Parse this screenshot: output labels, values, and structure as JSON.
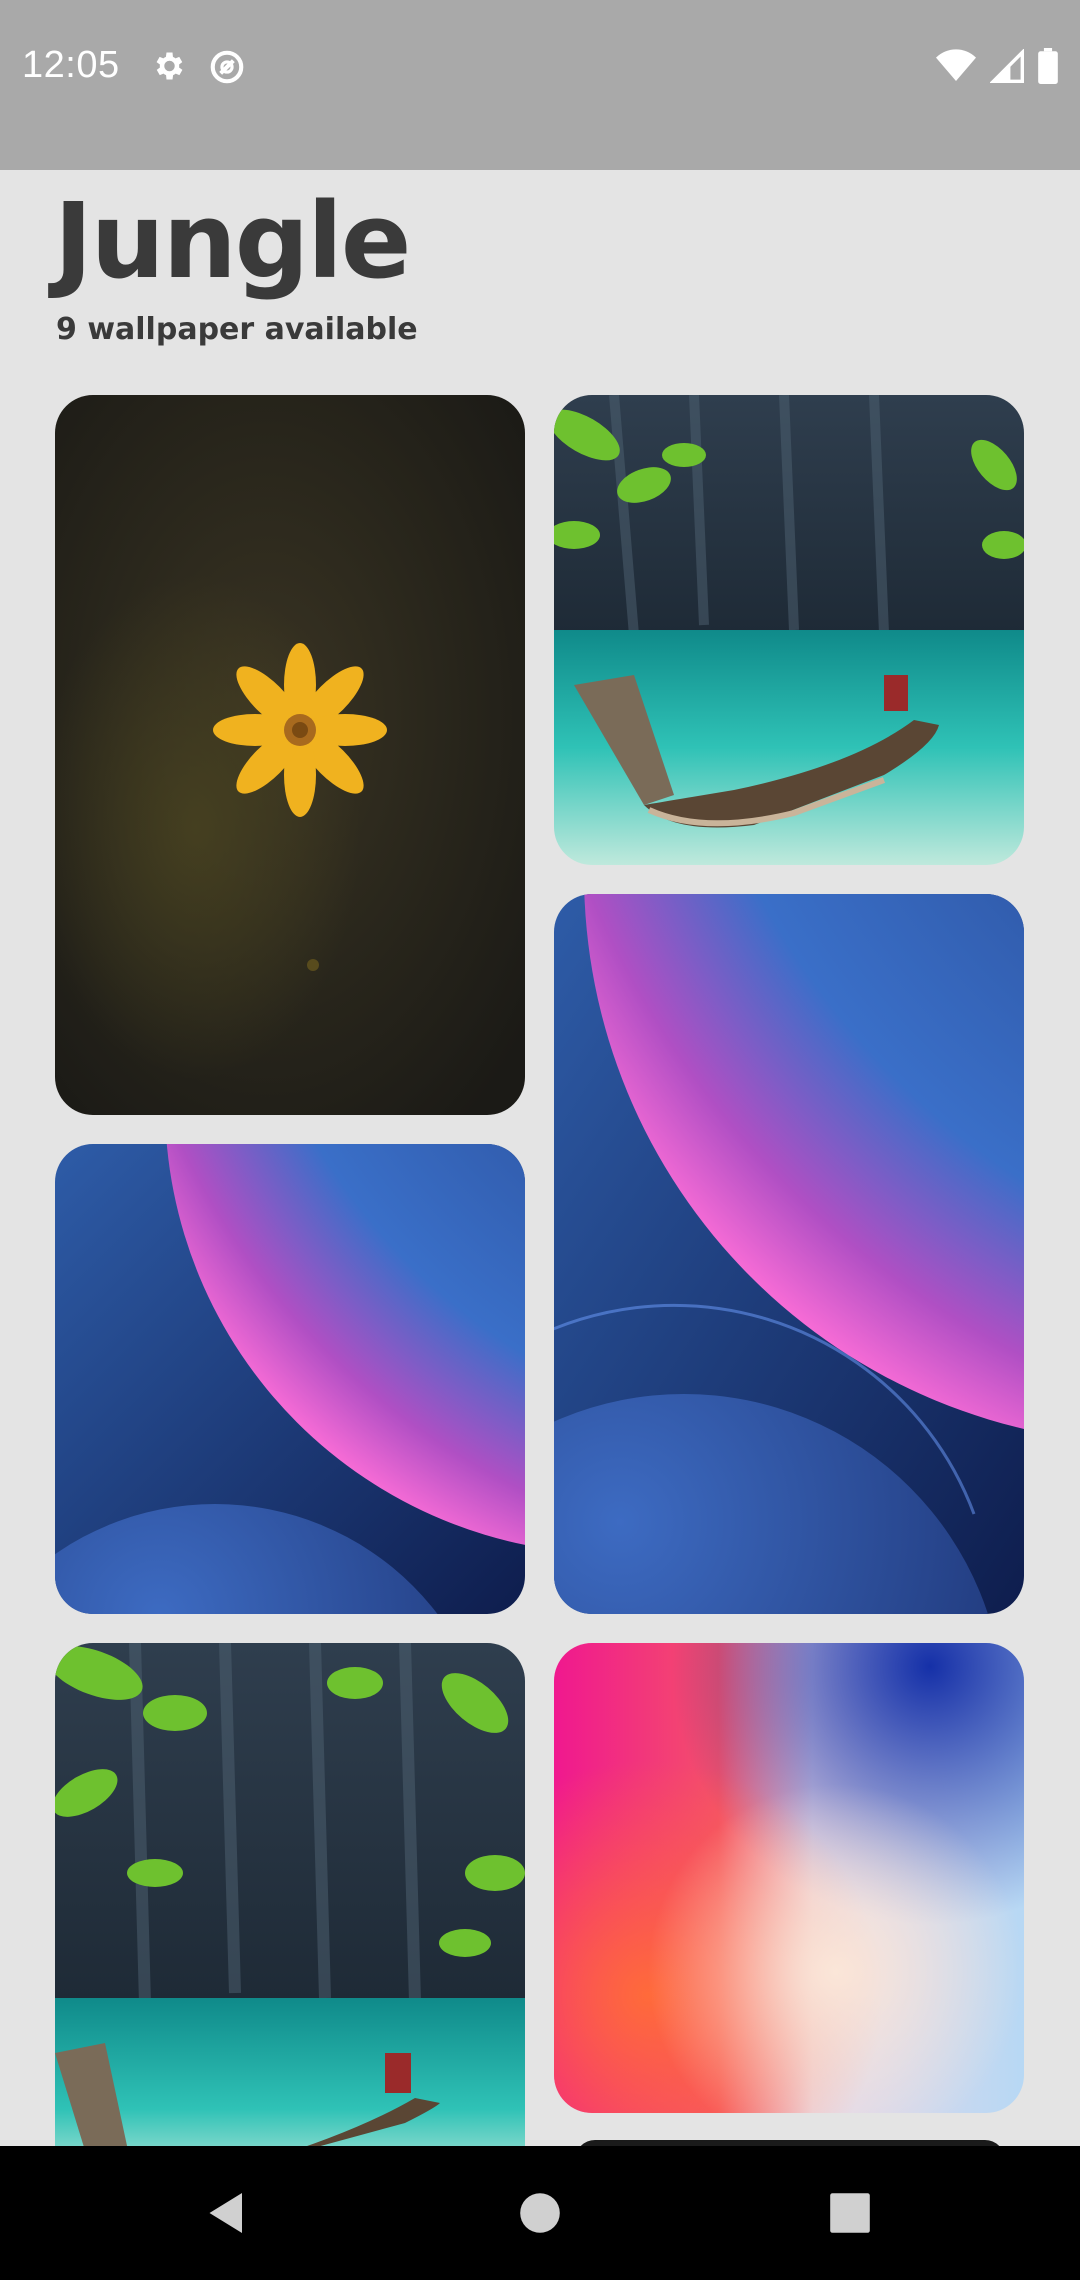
{
  "status_bar": {
    "time": "12:05",
    "left_icons": [
      "gear-icon",
      "data-saver-icon"
    ],
    "right_icons": [
      "wifi-icon",
      "signal-icon",
      "battery-icon"
    ]
  },
  "header": {
    "title": "Jungle",
    "subtitle": "9 wallpaper available"
  },
  "wallpapers": [
    {
      "id": "flower",
      "description_icon": "yellow-flower-on-dark"
    },
    {
      "id": "boat-1",
      "description_icon": "boat-lagoon"
    },
    {
      "id": "bubble-tall",
      "description_icon": "blue-purple-bubble"
    },
    {
      "id": "bubble-square",
      "description_icon": "blue-purple-bubble"
    },
    {
      "id": "boat-2",
      "description_icon": "boat-lagoon"
    },
    {
      "id": "gradient",
      "description_icon": "pink-blue-gradient"
    }
  ],
  "nav_bar": {
    "buttons": [
      "back-icon",
      "home-icon",
      "recents-icon"
    ]
  },
  "colors": {
    "background": "#e4e4e4",
    "status_bar": "#a9a9a9",
    "title_text": "#3a3a3a"
  }
}
